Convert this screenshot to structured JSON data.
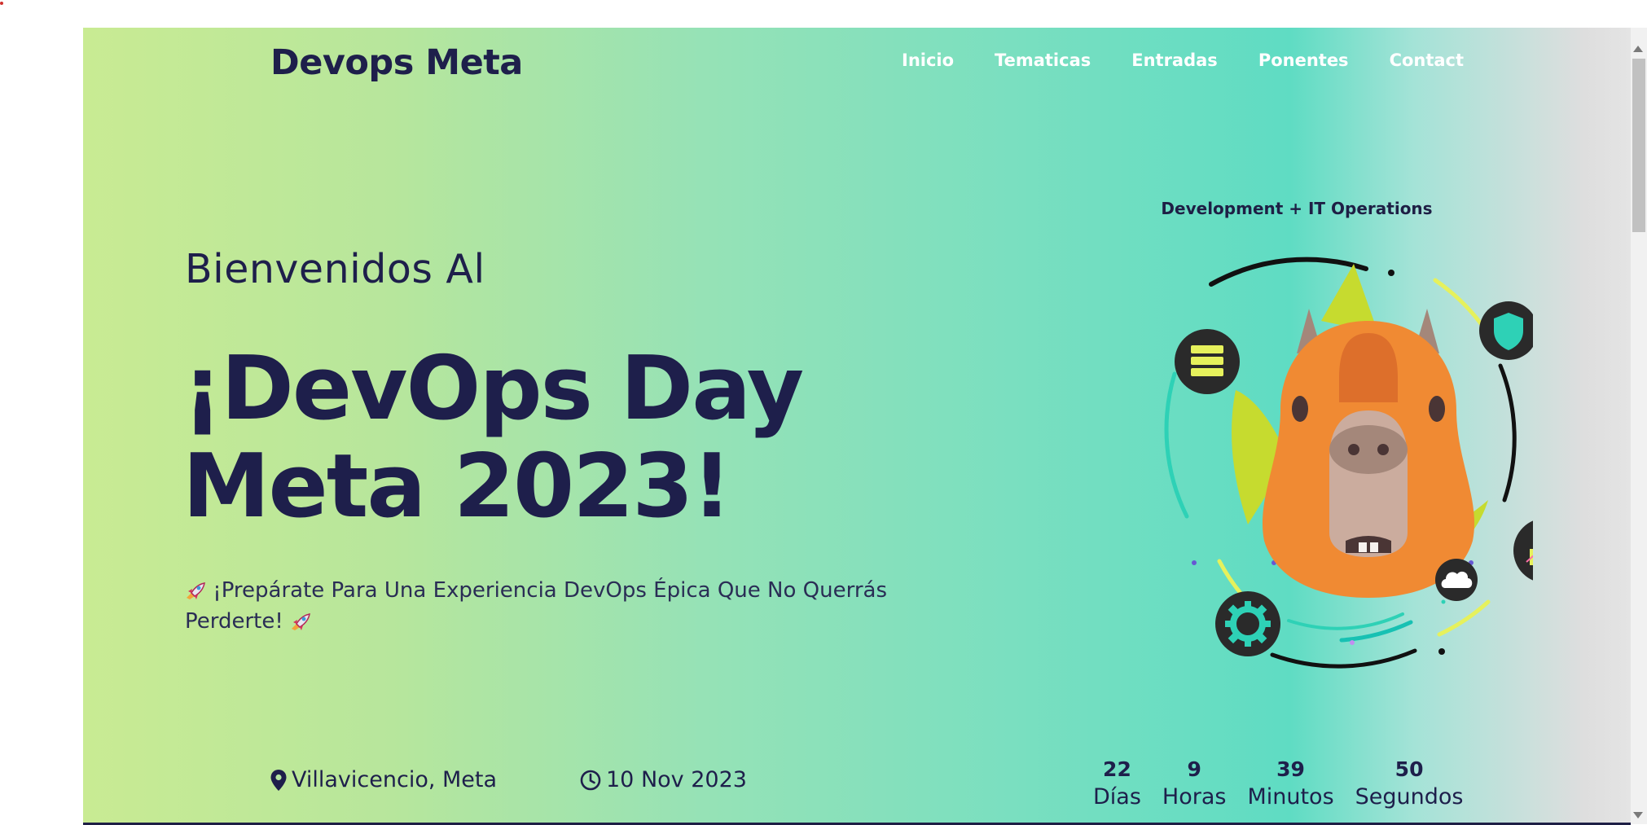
{
  "brand": {
    "name": "Devops Meta"
  },
  "nav": {
    "items": [
      "Inicio",
      "Tematicas",
      "Entradas",
      "Ponentes",
      "Contact"
    ]
  },
  "hero": {
    "welcome": "Bienvenidos Al",
    "title_line1": "¡DevOps Day",
    "title_line2": "Meta 2023!",
    "tagline": "¡Prepárate Para Una Experiencia DevOps Épica Que No Querrás Perderte!"
  },
  "event": {
    "location": "Villavicencio, Meta",
    "date": "10 Nov 2023"
  },
  "countdown": {
    "days": "22",
    "days_label": "Días",
    "hours": "9",
    "hours_label": "Horas",
    "minutes": "39",
    "minutes_label": "Minutos",
    "seconds": "50",
    "seconds_label": "Segundos"
  },
  "illustration": {
    "caption": "Development + IT Operations",
    "icons": [
      "database-icon",
      "shield-icon",
      "bar-chart-icon",
      "cloud-icon",
      "gear-icon",
      "capybara-mascot"
    ]
  },
  "icons": {
    "location": "map-pin-icon",
    "date": "clock-icon",
    "tagline": "rocket-icon"
  },
  "colors": {
    "brand_navy": "#1e1f4b",
    "gradient_start": "#c9eb93",
    "gradient_mid": "#5fdcc3",
    "gradient_end": "#e4e4e4",
    "accent_yellow": "#e6f15c",
    "accent_teal": "#2ed1b6",
    "mascot_orange": "#f08a33"
  }
}
